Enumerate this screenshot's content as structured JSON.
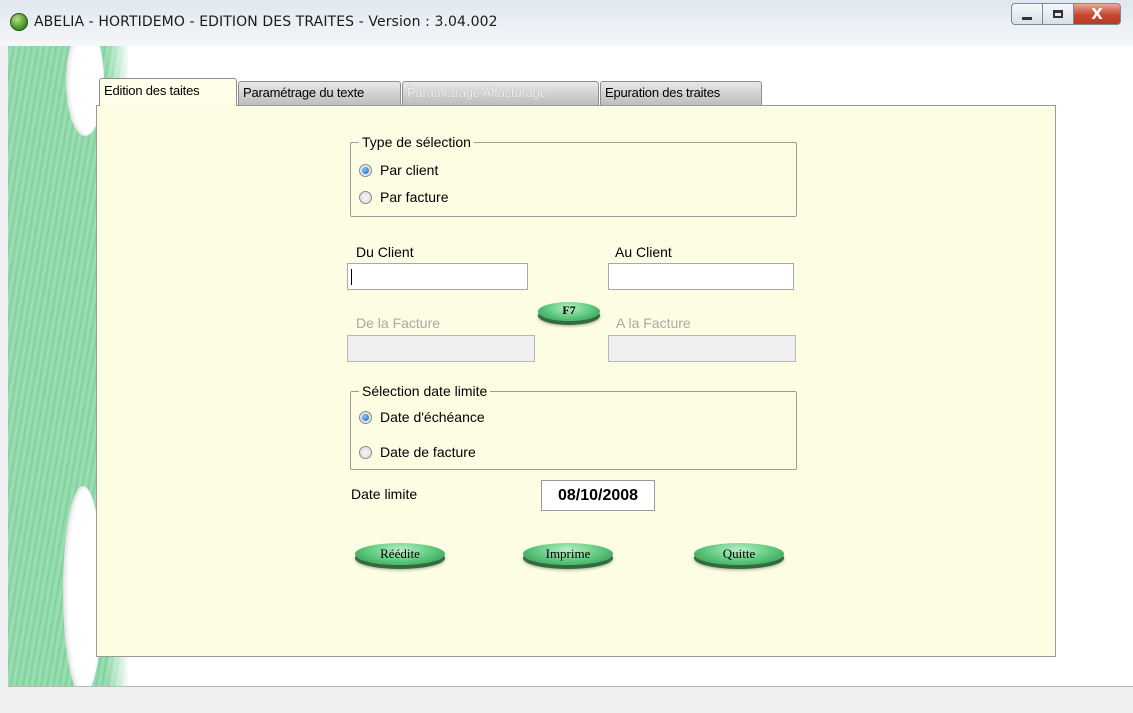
{
  "window": {
    "title": "ABELIA  -  HORTIDEMO  -  EDITION DES TRAITES  -  Version : 3.04.002",
    "minimize_icon": "minimize-icon",
    "maximize_icon": "maximize-icon",
    "close_label": "X"
  },
  "tabs": [
    {
      "label": "Edition des taites",
      "state": "active"
    },
    {
      "label": "Paramétrage du texte",
      "state": "normal"
    },
    {
      "label": "Paramétrage Affacturage",
      "state": "disabled"
    },
    {
      "label": "Epuration des traites",
      "state": "normal"
    }
  ],
  "selection_type": {
    "legend": "Type de sélection",
    "options": [
      {
        "label": "Par client",
        "checked": true
      },
      {
        "label": "Par facture",
        "checked": false
      }
    ]
  },
  "client_range": {
    "from_label": "Du Client",
    "from_value": "",
    "to_label": "Au Client",
    "to_value": ""
  },
  "f7_button": "F7",
  "invoice_range": {
    "from_label": "De la Facture",
    "from_value": "",
    "to_label": "A la Facture",
    "to_value": ""
  },
  "date_selection": {
    "legend": "Sélection date limite",
    "options": [
      {
        "label": "Date d'échéance",
        "checked": true
      },
      {
        "label": "Date de facture",
        "checked": false
      }
    ]
  },
  "date_limit": {
    "label": "Date limite",
    "value": "08/10/2008"
  },
  "actions": {
    "reedit": "Réédite",
    "print": "Imprime",
    "quit": "Quitte"
  },
  "colors": {
    "panel_bg": "#fdfde4",
    "button_green": "#59c679",
    "side_band": "#86d6a3"
  }
}
